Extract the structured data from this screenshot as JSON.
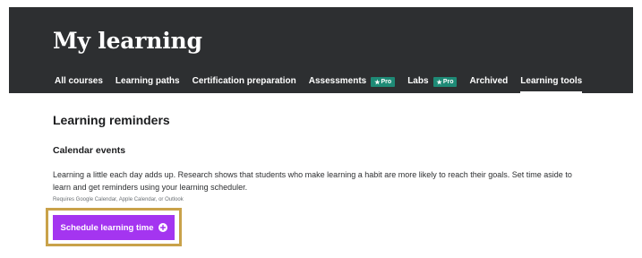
{
  "header": {
    "title": "My learning",
    "tabs": [
      {
        "label": "All courses"
      },
      {
        "label": "Learning paths"
      },
      {
        "label": "Certification preparation"
      },
      {
        "label": "Assessments",
        "badge": "Pro"
      },
      {
        "label": "Labs",
        "badge": "Pro"
      },
      {
        "label": "Archived"
      },
      {
        "label": "Learning tools",
        "active": true
      }
    ]
  },
  "main": {
    "section_title": "Learning reminders",
    "calendar": {
      "title": "Calendar events",
      "description": "Learning a little each day adds up. Research shows that students who make learning a habit are more likely to reach their goals. Set time aside to learn and get reminders using your learning scheduler.",
      "requirements": "Requires Google Calendar, Apple Calendar, or Outlook",
      "button_label": "Schedule learning time"
    }
  },
  "colors": {
    "header_bg": "#2d2f31",
    "badge_bg": "#1e8a76",
    "button_bg": "#a435f0",
    "highlight_border": "#c9a24a"
  },
  "icons": {
    "pro_badge_icon": "star-icon",
    "button_icon": "plus-circle-icon"
  }
}
